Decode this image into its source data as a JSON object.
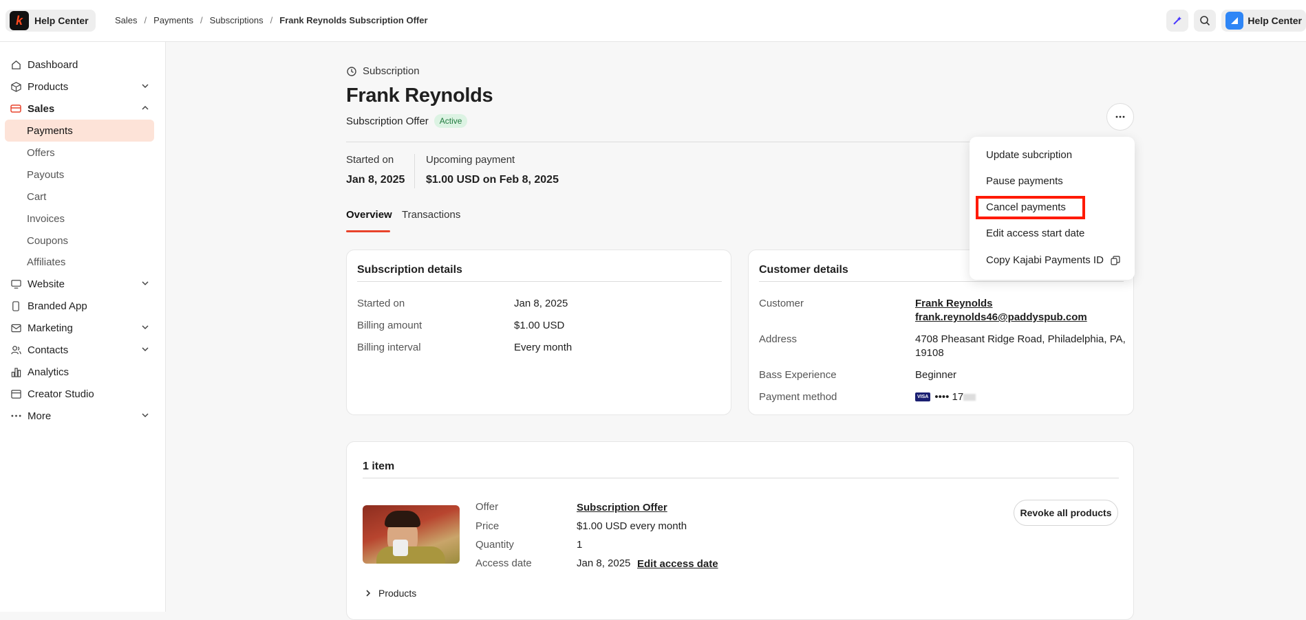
{
  "header": {
    "brand_label": "Help Center",
    "breadcrumb": [
      "Sales",
      "Payments",
      "Subscriptions",
      "Frank Reynolds Subscription Offer"
    ],
    "right_help_label": "Help Center"
  },
  "sidebar": {
    "items": [
      {
        "label": "Dashboard",
        "icon": "home-icon"
      },
      {
        "label": "Products",
        "icon": "box-icon",
        "expandable": true
      },
      {
        "label": "Sales",
        "icon": "card-icon",
        "expanded": true
      },
      {
        "label": "Payments",
        "active": true
      },
      {
        "label": "Offers"
      },
      {
        "label": "Payouts"
      },
      {
        "label": "Cart"
      },
      {
        "label": "Invoices"
      },
      {
        "label": "Coupons"
      },
      {
        "label": "Affiliates"
      },
      {
        "label": "Website",
        "icon": "monitor-icon",
        "expandable": true
      },
      {
        "label": "Branded App",
        "icon": "phone-icon"
      },
      {
        "label": "Marketing",
        "icon": "mail-icon",
        "expandable": true
      },
      {
        "label": "Contacts",
        "icon": "users-icon",
        "expandable": true
      },
      {
        "label": "Analytics",
        "icon": "chart-icon"
      },
      {
        "label": "Creator Studio",
        "icon": "calendar-icon"
      },
      {
        "label": "More",
        "icon": "dots-icon",
        "expandable": true
      }
    ]
  },
  "page": {
    "type_label": "Subscription",
    "customer_name": "Frank Reynolds",
    "offer_label": "Subscription Offer",
    "status": "Active",
    "started_on_label": "Started on",
    "started_on_value": "Jan 8, 2025",
    "upcoming_label": "Upcoming payment",
    "upcoming_value": "$1.00 USD on Feb 8, 2025",
    "tabs": [
      "Overview",
      "Transactions"
    ]
  },
  "subscription_details": {
    "title": "Subscription details",
    "rows": [
      {
        "key": "Started on",
        "value": "Jan 8, 2025"
      },
      {
        "key": "Billing amount",
        "value": "$1.00 USD"
      },
      {
        "key": "Billing interval",
        "value": "Every month"
      }
    ]
  },
  "customer_details": {
    "title": "Customer details",
    "customer_label": "Customer",
    "customer_name": "Frank Reynolds",
    "customer_email": "frank.reynolds46@paddyspub.com",
    "address_label": "Address",
    "address_line1": "4708 Pheasant Ridge Road, Philadelphia, PA,",
    "address_line2": "19108",
    "bass_label": "Bass Experience",
    "bass_value": "Beginner",
    "payment_label": "Payment method",
    "card_brand": "VISA",
    "card_mask": "•••• 17"
  },
  "menu": {
    "items": [
      "Update subcription",
      "Pause payments",
      "Cancel payments",
      "Edit access start date",
      "Copy Kajabi Payments ID"
    ]
  },
  "items_card": {
    "title": "1 item",
    "offer_label": "Offer",
    "offer_value": "Subscription Offer",
    "price_label": "Price",
    "price_value": "$1.00 USD every month",
    "quantity_label": "Quantity",
    "quantity_value": "1",
    "access_label": "Access date",
    "access_value": "Jan 8, 2025",
    "edit_access_link": "Edit access date",
    "revoke_button": "Revoke all products",
    "products_toggle": "Products"
  }
}
